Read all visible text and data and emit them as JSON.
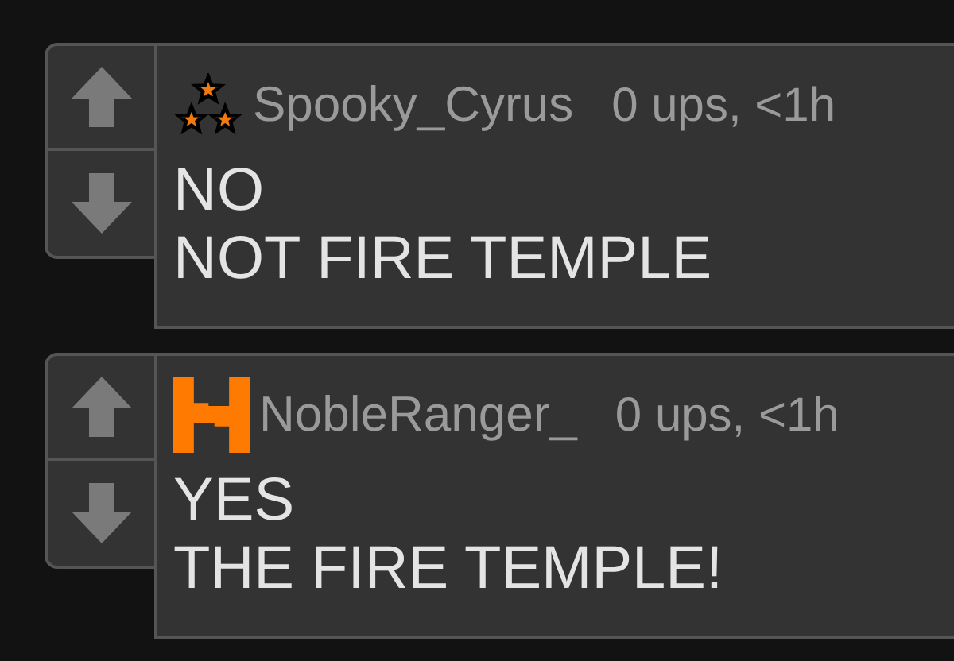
{
  "comments": [
    {
      "kind": "stars",
      "username": "Spooky_Cyrus",
      "meta": "0 ups, <1h",
      "lines": [
        "NO",
        "NOT FIRE TEMPLE"
      ]
    },
    {
      "kind": "block",
      "username": "NobleRanger_",
      "meta": "0 ups, <1h",
      "lines": [
        "YES",
        "THE FIRE TEMPLE!"
      ]
    }
  ]
}
